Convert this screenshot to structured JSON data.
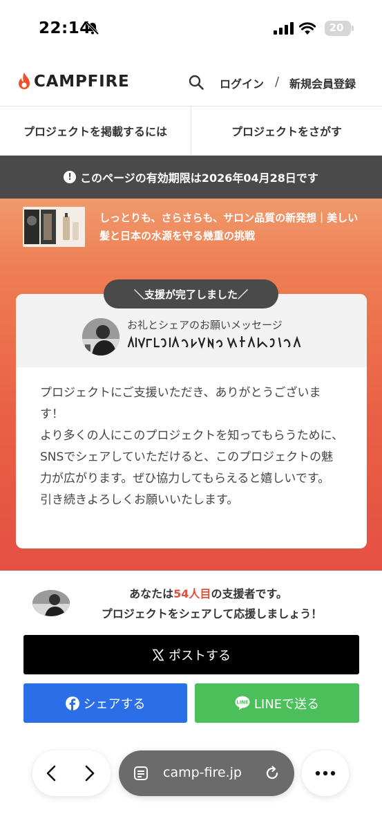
{
  "status_bar": {
    "time": "22:14",
    "battery": "20",
    "icons": [
      "bell-slash-icon",
      "signal-icon",
      "wifi-icon",
      "battery-icon"
    ]
  },
  "header": {
    "logo": "CAMPFIRE",
    "login": "ログイン",
    "separator": "/",
    "register": "新規会員登録",
    "brand_color": "#e8532c"
  },
  "tabs": [
    {
      "label": "プロジェクトを掲載するには"
    },
    {
      "label": "プロジェクトをさがす"
    }
  ],
  "expiry_notice": "このページの有効期限は2026年04月28日です",
  "project": {
    "title": "しっとりも、さらさらも、サロン品質の新発想｜美しい髪と日本の水源を守る幾重の挑戦"
  },
  "completion": {
    "badge": "＼支援が完了しました／",
    "message_label": "お礼とシェアのお願いメッセージ",
    "message_body": "プロジェクトにご支援いただき、ありがとうございます！\nより多くの人にこのプロジェクトを知ってもらうために、SNSでシェアしていただけると、このプロジェクトの魅力が広がります。ぜひ協力してもらえると嬉しいです。\n引き続きよろしくお願いいたします。"
  },
  "supporter": {
    "line1_prefix": "あなたは",
    "count": "54人目",
    "line1_suffix": "の支援者です。",
    "line2": "プロジェクトをシェアして応援しましょう！"
  },
  "share": {
    "x_label": "ポストする",
    "facebook_label": "シェアする",
    "line_label": "LINEで送る",
    "colors": {
      "x": "#000000",
      "facebook": "#2a6ee8",
      "line": "#4bbf5a"
    }
  },
  "browser": {
    "url": "camp-fire.jp"
  }
}
